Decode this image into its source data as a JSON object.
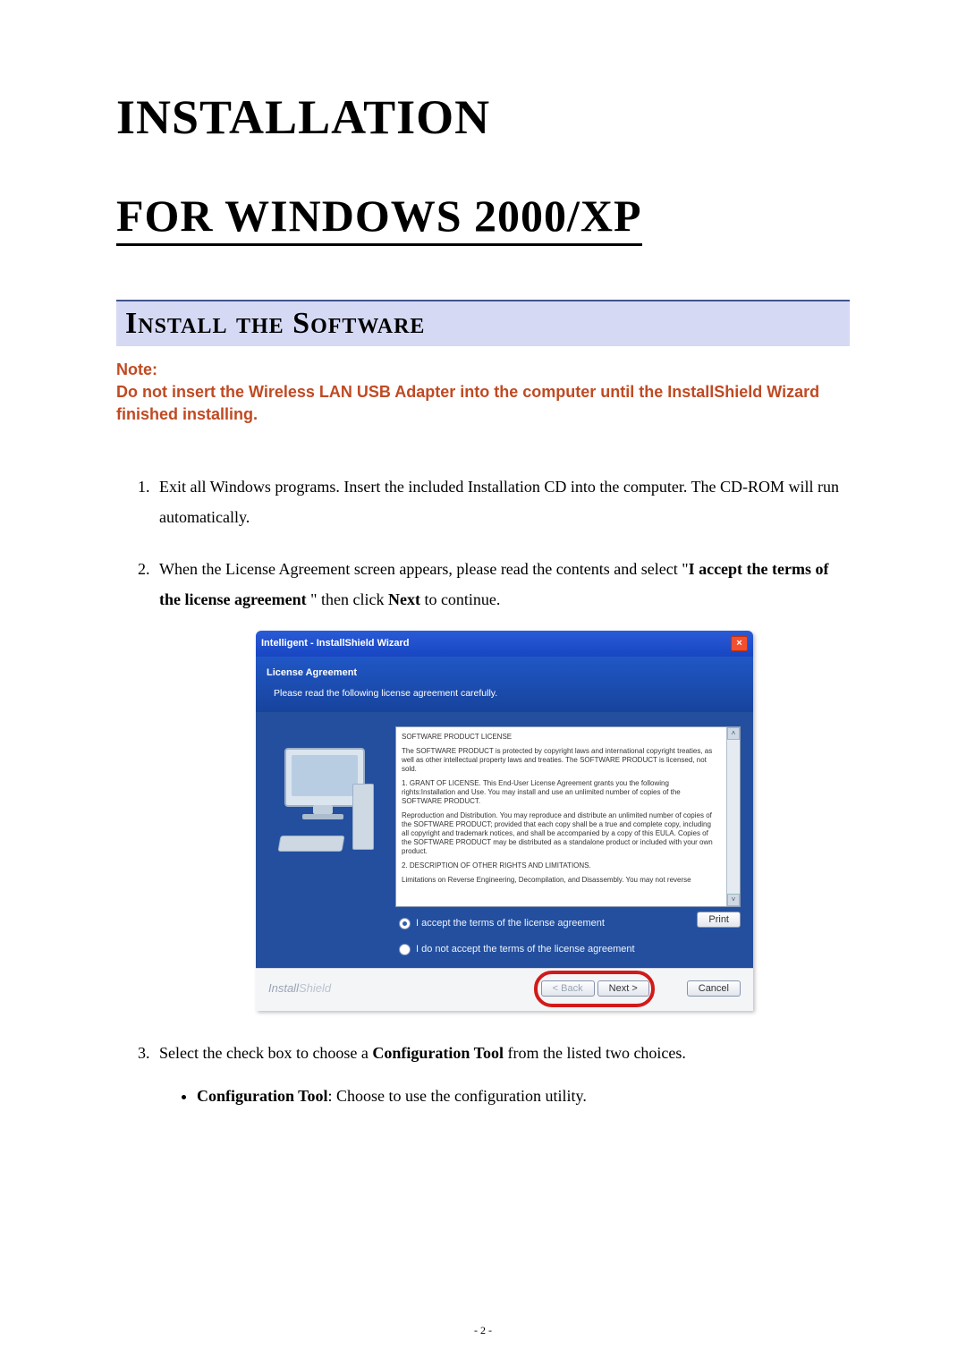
{
  "heading1": "INSTALLATION",
  "heading2": "FOR WINDOWS 2000/XP",
  "section_title": "Install the Software",
  "note_label": "Note:",
  "note_body": "Do not insert the Wireless LAN USB Adapter into the computer until the InstallShield Wizard finished installing.",
  "steps": {
    "s1": "Exit all Windows programs. Insert the included Installation CD into the computer. The CD-ROM will run automatically.",
    "s2_a": "When the License Agreement screen appears, please read the contents and select \"",
    "s2_bold1": "I accept the terms of the license agreement",
    "s2_b": " \" then click ",
    "s2_bold2": "Next",
    "s2_c": " to continue.",
    "s3_a": "Select the check box to choose a ",
    "s3_bold": "Configuration Tool",
    "s3_b": " from the listed two choices.",
    "sub_bold": "Configuration Tool",
    "sub_rest": ": Choose to use the configuration utility."
  },
  "wizard": {
    "title": "Intelligent - InstallShield Wizard",
    "close": "×",
    "subheading": "License Agreement",
    "instruction": "Please read the following license agreement carefully.",
    "license": {
      "l1": "SOFTWARE PRODUCT LICENSE",
      "l2": "The SOFTWARE PRODUCT is protected by copyright laws and international copyright treaties, as well as other intellectual property laws and treaties. The SOFTWARE PRODUCT is licensed, not sold.",
      "l3": "1. GRANT OF LICENSE. This End-User License Agreement grants you the following rights:Installation and Use. You may install and use an unlimited number of copies of the SOFTWARE PRODUCT.",
      "l4": "Reproduction and Distribution. You may reproduce and distribute an unlimited number of copies of the SOFTWARE PRODUCT; provided that each copy shall be a true and complete copy, including all copyright and trademark notices, and shall be accompanied by a copy of this EULA. Copies of the SOFTWARE PRODUCT may be distributed as a standalone product or included with your own product.",
      "l5": "2. DESCRIPTION OF OTHER RIGHTS AND LIMITATIONS.",
      "l6": "Limitations on Reverse Engineering, Decompilation, and Disassembly. You may not reverse"
    },
    "accept": "I accept the terms of the license agreement",
    "reject": "I do not accept the terms of the license agreement",
    "print": "Print",
    "back": "< Back",
    "next": "Next >",
    "cancel": "Cancel",
    "brand_a": "Install",
    "brand_b": "Shield",
    "scroll_up": "˄",
    "scroll_down": "˅"
  },
  "page_number": "- 2 -"
}
